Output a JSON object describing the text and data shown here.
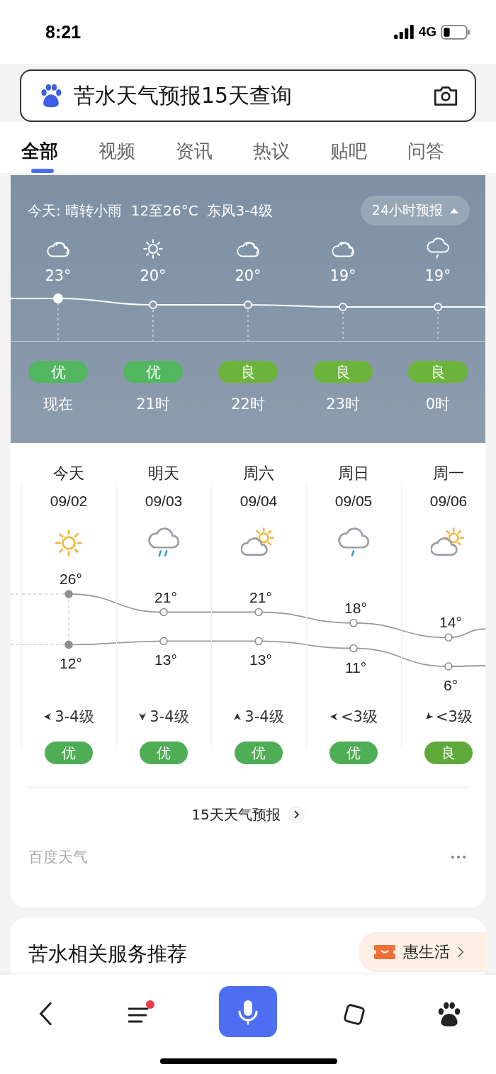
{
  "status_bar": {
    "time": "8:21",
    "network": "4G"
  },
  "search": {
    "value": "苦水天气预报15天查询"
  },
  "tabs": [
    {
      "label": "全部",
      "selected": true
    },
    {
      "label": "视频",
      "selected": false
    },
    {
      "label": "资讯",
      "selected": false
    },
    {
      "label": "热议",
      "selected": false
    },
    {
      "label": "贴吧",
      "selected": false
    },
    {
      "label": "问答",
      "selected": false
    }
  ],
  "hourly": {
    "summary": "今天: 晴转小雨  12至26°C  东风3-4级",
    "toggle": "24小时预报",
    "expanded": true,
    "hours": [
      {
        "kind": "cloud",
        "temp": "23°",
        "aqi": "优",
        "color": "#52b660",
        "time": "现在",
        "current": true
      },
      {
        "kind": "sun",
        "temp": "20°",
        "aqi": "优",
        "color": "#52b660",
        "time": "21时",
        "current": false
      },
      {
        "kind": "cloud",
        "temp": "20°",
        "aqi": "良",
        "color": "#6cb43c",
        "time": "22时",
        "current": false
      },
      {
        "kind": "cloud",
        "temp": "19°",
        "aqi": "良",
        "color": "#6cb43c",
        "time": "23时",
        "current": false
      },
      {
        "kind": "drizzle",
        "temp": "19°",
        "aqi": "良",
        "color": "#6cb43c",
        "time": "0时",
        "current": false
      }
    ]
  },
  "daily": {
    "days": [
      {
        "day": "今天",
        "date": "09/02",
        "kind": "sun",
        "high": "26°",
        "low": "12°",
        "wind": {
          "kind": "left",
          "text": "3-4级"
        },
        "aqi": "优",
        "color": "#4fae55",
        "current": true
      },
      {
        "day": "明天",
        "date": "09/03",
        "kind": "rain",
        "high": "21°",
        "low": "13°",
        "wind": {
          "kind": "down",
          "text": "3-4级"
        },
        "aqi": "优",
        "color": "#4fae55",
        "current": false
      },
      {
        "day": "周六",
        "date": "09/04",
        "kind": "partly",
        "high": "21°",
        "low": "13°",
        "wind": {
          "kind": "up",
          "text": "3-4级"
        },
        "aqi": "优",
        "color": "#4fae55",
        "current": false
      },
      {
        "day": "周日",
        "date": "09/05",
        "kind": "drizzle",
        "high": "18°",
        "low": "11°",
        "wind": {
          "kind": "left",
          "text": "<3级"
        },
        "aqi": "优",
        "color": "#4fae55",
        "current": false
      },
      {
        "day": "周一",
        "date": "09/06",
        "kind": "partly",
        "high": "14°",
        "low": "6°",
        "wind": {
          "kind": "down-left",
          "text": "<3级"
        },
        "aqi": "良",
        "color": "#5fa83a",
        "current": false
      }
    ],
    "more_link": "15天天气预报",
    "source": "百度天气"
  },
  "services": {
    "title": "苦水相关服务推荐",
    "chip": "惠生活"
  },
  "nav": {
    "menu_badge": true
  }
}
